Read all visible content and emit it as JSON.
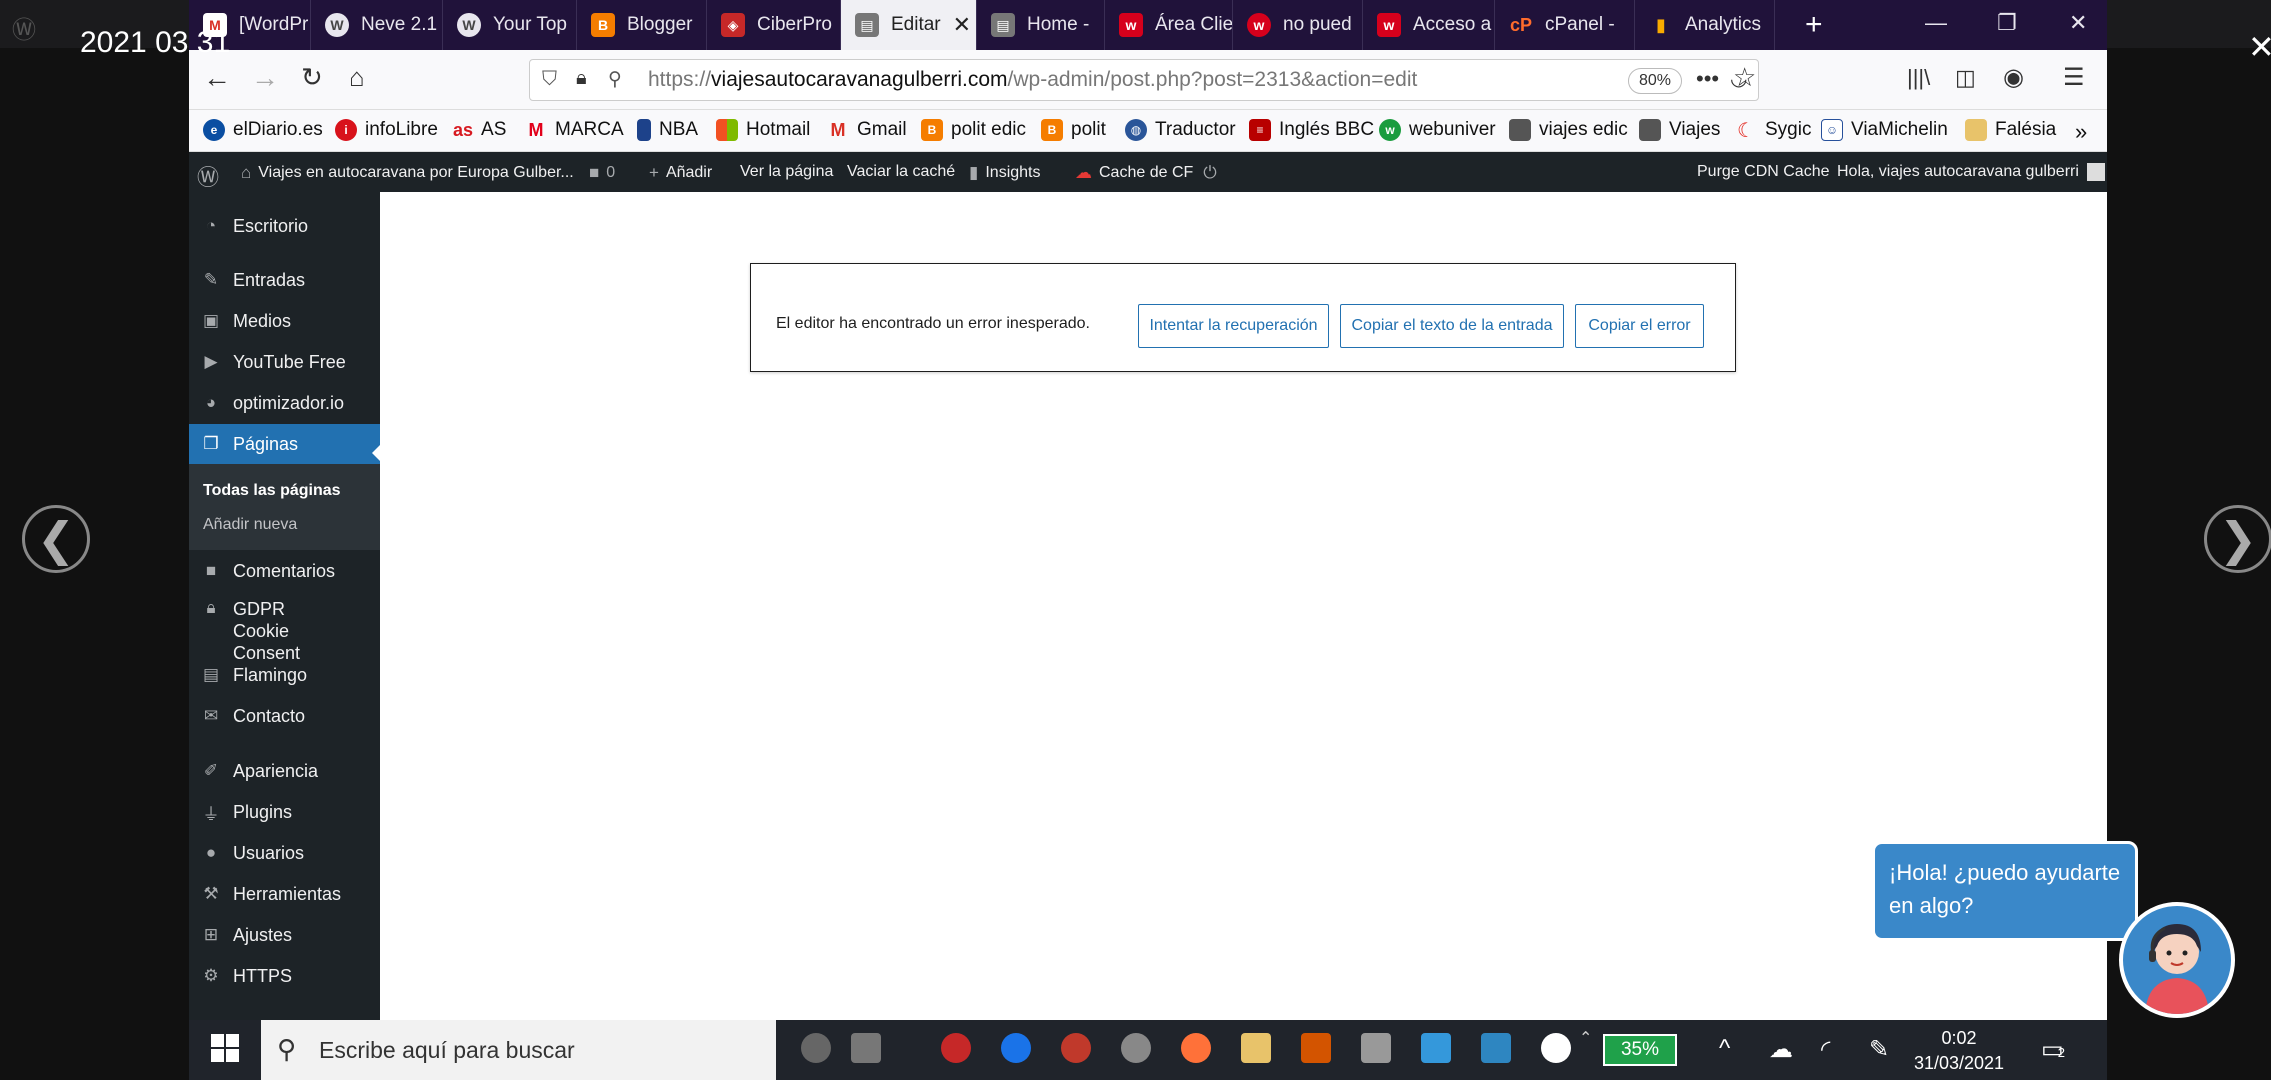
{
  "overlay": {
    "timestamp": "2021 03 31",
    "prev_label": "❮",
    "next_label": "❯",
    "close_label": "✕"
  },
  "browser": {
    "tabs": [
      {
        "label": "[WordPr",
        "icon": "gmail-icon",
        "color": "#d93025"
      },
      {
        "label": "Neve 2.1",
        "icon": "wordpress-icon",
        "color": "#464646"
      },
      {
        "label": "Your Top",
        "icon": "wordpress-icon",
        "color": "#464646"
      },
      {
        "label": "Blogger",
        "icon": "blogger-icon",
        "color": "#f57d00"
      },
      {
        "label": "CiberPro",
        "icon": "shield-icon",
        "color": "#c62828"
      },
      {
        "label": "Editar",
        "icon": "page-icon",
        "color": "#555"
      },
      {
        "label": "Home -",
        "icon": "page-icon",
        "color": "#555"
      },
      {
        "label": "Área Clie",
        "icon": "webempresa-icon",
        "color": "#d6001c"
      },
      {
        "label": "no pued",
        "icon": "webempresa-icon",
        "color": "#d6001c"
      },
      {
        "label": "Acceso a",
        "icon": "webempresa-icon",
        "color": "#d6001c"
      },
      {
        "label": "cPanel -",
        "icon": "cpanel-icon",
        "color": "#ff6c2c"
      },
      {
        "label": "Analytics",
        "icon": "analytics-icon",
        "color": "#f9ab00"
      }
    ],
    "url_prefix": "https://",
    "url_domain": "viajesautocaravanagulberri.com",
    "url_path": "/wp-admin/post.php?post=2313&action=edit",
    "zoom": "80%",
    "bookmarks": [
      {
        "label": "elDiario.es",
        "color": "#0a4ea2"
      },
      {
        "label": "infoLibre",
        "color": "#d8121b"
      },
      {
        "label": "AS",
        "color": "#d71920"
      },
      {
        "label": "MARCA",
        "color": "#e2001a"
      },
      {
        "label": "NBA",
        "color": "#1d428a"
      },
      {
        "label": "Hotmail",
        "color": "#f25022"
      },
      {
        "label": "Gmail",
        "color": "#d93025"
      },
      {
        "label": "polit edic",
        "color": "#f57d00"
      },
      {
        "label": "polit",
        "color": "#f57d00"
      },
      {
        "label": "Traductor",
        "color": "#2a5599"
      },
      {
        "label": "Inglés BBC",
        "color": "#b80000"
      },
      {
        "label": "webuniver",
        "color": "#1a9c3e"
      },
      {
        "label": "viajes edic",
        "color": "#555"
      },
      {
        "label": "Viajes",
        "color": "#555"
      },
      {
        "label": "Sygic",
        "color": "#e2231a"
      },
      {
        "label": "ViaMichelin",
        "color": "#27509b"
      },
      {
        "label": "Falésia",
        "color": "#e8c36a"
      }
    ]
  },
  "adminbar": {
    "site": "Viajes en autocaravana por Europa Gulber...",
    "comments": "0",
    "add_new": "Añadir",
    "view_page": "Ver la página",
    "clear_cache": "Vaciar la caché",
    "insights": "Insights",
    "cf_cache": "Cache de CF",
    "purge_cdn": "Purge CDN Cache",
    "greeting": "Hola, viajes autocaravana gulberri"
  },
  "sidebar": {
    "items": [
      {
        "label": "Escritorio",
        "icon": "dashboard-icon"
      },
      {
        "label": "Entradas",
        "icon": "pin-icon"
      },
      {
        "label": "Medios",
        "icon": "media-icon"
      },
      {
        "label": "YouTube Free",
        "icon": "youtube-icon"
      },
      {
        "label": "optimizador.io",
        "icon": "gauge-icon"
      },
      {
        "label": "Páginas",
        "icon": "pages-icon"
      },
      {
        "label": "Comentarios",
        "icon": "comment-icon"
      },
      {
        "label": "GDPR Cookie Consent",
        "icon": "lock-icon"
      },
      {
        "label": "Flamingo",
        "icon": "list-icon"
      },
      {
        "label": "Contacto",
        "icon": "mail-icon"
      },
      {
        "label": "Apariencia",
        "icon": "brush-icon"
      },
      {
        "label": "Plugins",
        "icon": "plug-icon"
      },
      {
        "label": "Usuarios",
        "icon": "user-icon"
      },
      {
        "label": "Herramientas",
        "icon": "wrench-icon"
      },
      {
        "label": "Ajustes",
        "icon": "settings-icon"
      },
      {
        "label": "HTTPS",
        "icon": "gear-icon"
      }
    ],
    "submenu": [
      "Todas las páginas",
      "Añadir nueva"
    ]
  },
  "editor_error": {
    "message": "El editor ha encontrado un error inesperado.",
    "buttons": [
      "Intentar la recuperación",
      "Copiar el texto de la entrada",
      "Copiar el error"
    ]
  },
  "chat": {
    "message": "¡Hola! ¿puedo ayudarte en algo?"
  },
  "taskbar": {
    "search_placeholder": "Escribe aquí para buscar",
    "battery": "35%",
    "time": "0:02",
    "date": "31/03/2021",
    "notifications": "2"
  },
  "colors": {
    "wp_admin_dark": "#1d2327",
    "wp_blue": "#2271b1",
    "firefox_tabbar": "#20123a",
    "chat_blue": "#3a88c9"
  }
}
